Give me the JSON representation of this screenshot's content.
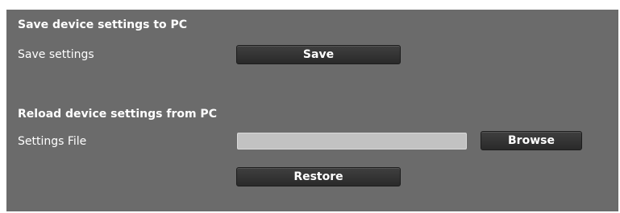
{
  "save_section": {
    "title": "Save device settings to PC",
    "label": "Save settings",
    "button_label": "Save"
  },
  "reload_section": {
    "title": "Reload device settings from PC",
    "file_label": "Settings File",
    "file_value": "",
    "browse_label": "Browse",
    "restore_label": "Restore"
  },
  "colors": {
    "panel_background": "#6b6b6b",
    "button_background": "#333333",
    "text": "#ffffff",
    "input_background": "#c2c2c2"
  }
}
